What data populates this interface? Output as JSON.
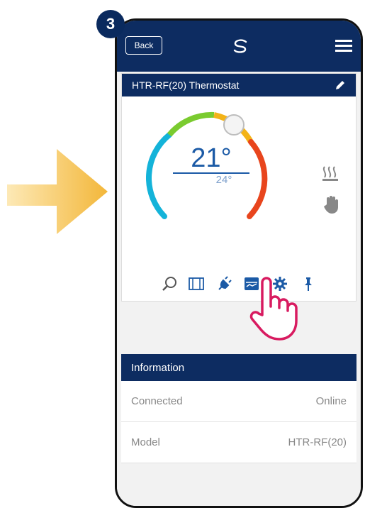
{
  "step_number": "3",
  "app": {
    "back_label": "Back",
    "logo_icon": "salus-logo-icon",
    "menu_icon": "hamburger-icon"
  },
  "thermostat": {
    "title": "HTR-RF(20) Thermostat",
    "current_temp": "21°",
    "set_temp": "24°",
    "status_icons": [
      "heating-icon",
      "manual-hand-icon"
    ]
  },
  "toolbar": {
    "icons": [
      "search-view-icon",
      "window-icon",
      "plug-icon",
      "schedule-icon",
      "settings-gear-icon",
      "pin-icon"
    ],
    "active": "schedule-icon"
  },
  "information": {
    "header": "Information",
    "rows": [
      {
        "label": "Connected",
        "value": "Online"
      },
      {
        "label": "Model",
        "value": "HTR-RF(20)"
      }
    ]
  },
  "colors": {
    "brand_navy": "#0d2c61",
    "temp_blue": "#1b5aa6",
    "pointer_pink": "#d81b60",
    "arrow_yellow": "#f3b73a"
  }
}
